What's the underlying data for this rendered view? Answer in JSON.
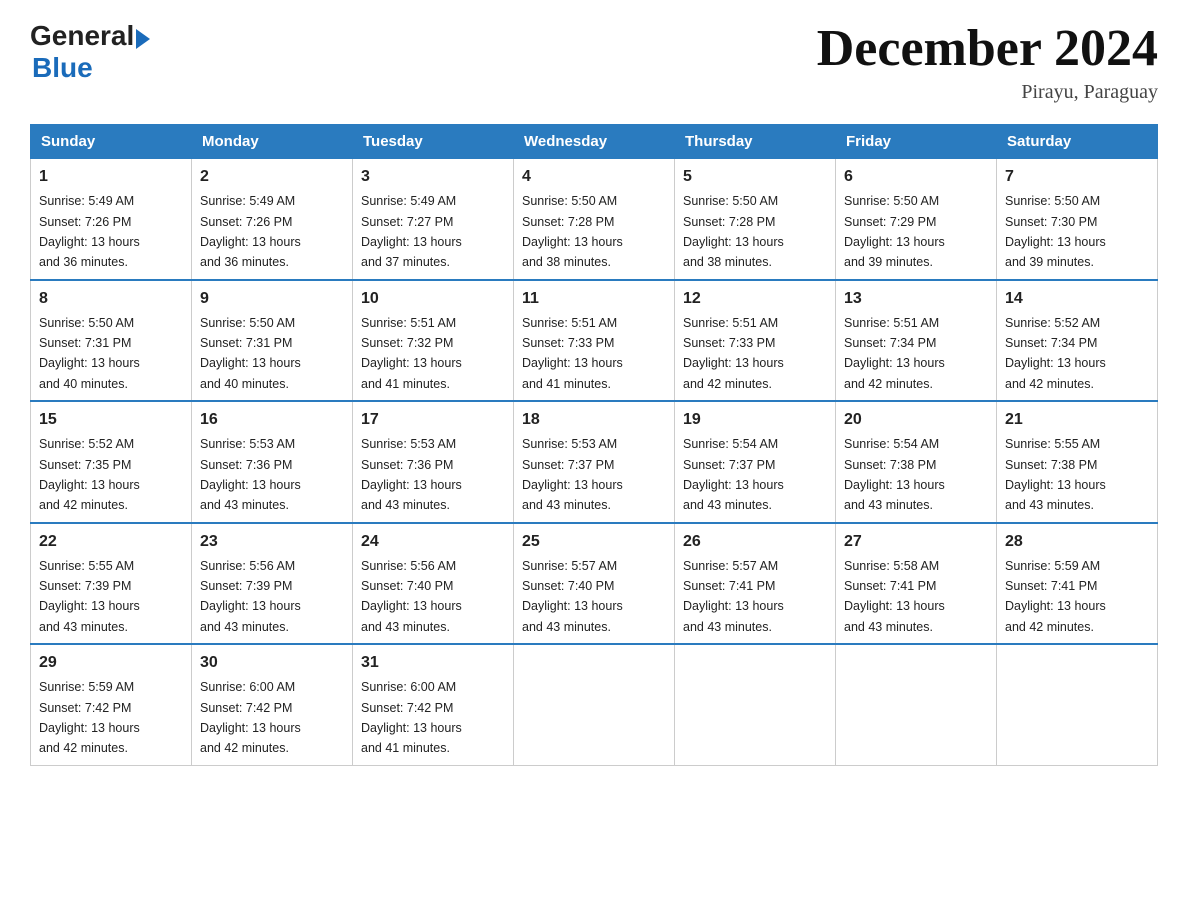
{
  "header": {
    "logo_general": "General",
    "logo_blue": "Blue",
    "title": "December 2024",
    "location": "Pirayu, Paraguay"
  },
  "days_of_week": [
    "Sunday",
    "Monday",
    "Tuesday",
    "Wednesday",
    "Thursday",
    "Friday",
    "Saturday"
  ],
  "weeks": [
    [
      {
        "day": "1",
        "sunrise": "5:49 AM",
        "sunset": "7:26 PM",
        "daylight": "13 hours and 36 minutes."
      },
      {
        "day": "2",
        "sunrise": "5:49 AM",
        "sunset": "7:26 PM",
        "daylight": "13 hours and 36 minutes."
      },
      {
        "day": "3",
        "sunrise": "5:49 AM",
        "sunset": "7:27 PM",
        "daylight": "13 hours and 37 minutes."
      },
      {
        "day": "4",
        "sunrise": "5:50 AM",
        "sunset": "7:28 PM",
        "daylight": "13 hours and 38 minutes."
      },
      {
        "day": "5",
        "sunrise": "5:50 AM",
        "sunset": "7:28 PM",
        "daylight": "13 hours and 38 minutes."
      },
      {
        "day": "6",
        "sunrise": "5:50 AM",
        "sunset": "7:29 PM",
        "daylight": "13 hours and 39 minutes."
      },
      {
        "day": "7",
        "sunrise": "5:50 AM",
        "sunset": "7:30 PM",
        "daylight": "13 hours and 39 minutes."
      }
    ],
    [
      {
        "day": "8",
        "sunrise": "5:50 AM",
        "sunset": "7:31 PM",
        "daylight": "13 hours and 40 minutes."
      },
      {
        "day": "9",
        "sunrise": "5:50 AM",
        "sunset": "7:31 PM",
        "daylight": "13 hours and 40 minutes."
      },
      {
        "day": "10",
        "sunrise": "5:51 AM",
        "sunset": "7:32 PM",
        "daylight": "13 hours and 41 minutes."
      },
      {
        "day": "11",
        "sunrise": "5:51 AM",
        "sunset": "7:33 PM",
        "daylight": "13 hours and 41 minutes."
      },
      {
        "day": "12",
        "sunrise": "5:51 AM",
        "sunset": "7:33 PM",
        "daylight": "13 hours and 42 minutes."
      },
      {
        "day": "13",
        "sunrise": "5:51 AM",
        "sunset": "7:34 PM",
        "daylight": "13 hours and 42 minutes."
      },
      {
        "day": "14",
        "sunrise": "5:52 AM",
        "sunset": "7:34 PM",
        "daylight": "13 hours and 42 minutes."
      }
    ],
    [
      {
        "day": "15",
        "sunrise": "5:52 AM",
        "sunset": "7:35 PM",
        "daylight": "13 hours and 42 minutes."
      },
      {
        "day": "16",
        "sunrise": "5:53 AM",
        "sunset": "7:36 PM",
        "daylight": "13 hours and 43 minutes."
      },
      {
        "day": "17",
        "sunrise": "5:53 AM",
        "sunset": "7:36 PM",
        "daylight": "13 hours and 43 minutes."
      },
      {
        "day": "18",
        "sunrise": "5:53 AM",
        "sunset": "7:37 PM",
        "daylight": "13 hours and 43 minutes."
      },
      {
        "day": "19",
        "sunrise": "5:54 AM",
        "sunset": "7:37 PM",
        "daylight": "13 hours and 43 minutes."
      },
      {
        "day": "20",
        "sunrise": "5:54 AM",
        "sunset": "7:38 PM",
        "daylight": "13 hours and 43 minutes."
      },
      {
        "day": "21",
        "sunrise": "5:55 AM",
        "sunset": "7:38 PM",
        "daylight": "13 hours and 43 minutes."
      }
    ],
    [
      {
        "day": "22",
        "sunrise": "5:55 AM",
        "sunset": "7:39 PM",
        "daylight": "13 hours and 43 minutes."
      },
      {
        "day": "23",
        "sunrise": "5:56 AM",
        "sunset": "7:39 PM",
        "daylight": "13 hours and 43 minutes."
      },
      {
        "day": "24",
        "sunrise": "5:56 AM",
        "sunset": "7:40 PM",
        "daylight": "13 hours and 43 minutes."
      },
      {
        "day": "25",
        "sunrise": "5:57 AM",
        "sunset": "7:40 PM",
        "daylight": "13 hours and 43 minutes."
      },
      {
        "day": "26",
        "sunrise": "5:57 AM",
        "sunset": "7:41 PM",
        "daylight": "13 hours and 43 minutes."
      },
      {
        "day": "27",
        "sunrise": "5:58 AM",
        "sunset": "7:41 PM",
        "daylight": "13 hours and 43 minutes."
      },
      {
        "day": "28",
        "sunrise": "5:59 AM",
        "sunset": "7:41 PM",
        "daylight": "13 hours and 42 minutes."
      }
    ],
    [
      {
        "day": "29",
        "sunrise": "5:59 AM",
        "sunset": "7:42 PM",
        "daylight": "13 hours and 42 minutes."
      },
      {
        "day": "30",
        "sunrise": "6:00 AM",
        "sunset": "7:42 PM",
        "daylight": "13 hours and 42 minutes."
      },
      {
        "day": "31",
        "sunrise": "6:00 AM",
        "sunset": "7:42 PM",
        "daylight": "13 hours and 41 minutes."
      },
      null,
      null,
      null,
      null
    ]
  ],
  "labels": {
    "sunrise": "Sunrise:",
    "sunset": "Sunset:",
    "daylight": "Daylight:"
  }
}
